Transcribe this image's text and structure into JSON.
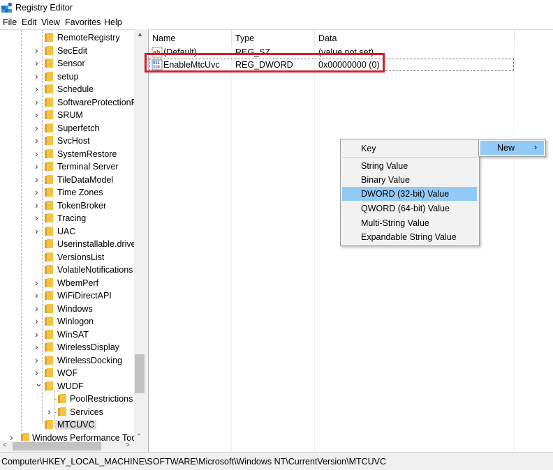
{
  "window": {
    "title": "Registry Editor"
  },
  "menu": [
    "File",
    "Edit",
    "View",
    "Favorites",
    "Help"
  ],
  "tree": [
    {
      "label": "RemoteRegistry",
      "chevron": ""
    },
    {
      "label": "SecEdit",
      "chevron": "›"
    },
    {
      "label": "Sensor",
      "chevron": "›"
    },
    {
      "label": "setup",
      "chevron": "›"
    },
    {
      "label": "Schedule",
      "chevron": "›"
    },
    {
      "label": "SoftwareProtectionPl",
      "chevron": "›"
    },
    {
      "label": "SRUM",
      "chevron": "›"
    },
    {
      "label": "Superfetch",
      "chevron": "›"
    },
    {
      "label": "SvcHost",
      "chevron": "›"
    },
    {
      "label": "SystemRestore",
      "chevron": "›"
    },
    {
      "label": "Terminal Server",
      "chevron": "›"
    },
    {
      "label": "TileDataModel",
      "chevron": "›"
    },
    {
      "label": "Time Zones",
      "chevron": "›"
    },
    {
      "label": "TokenBroker",
      "chevron": "›"
    },
    {
      "label": "Tracing",
      "chevron": "›"
    },
    {
      "label": "UAC",
      "chevron": "›"
    },
    {
      "label": "Userinstallable.driver",
      "chevron": ""
    },
    {
      "label": "VersionsList",
      "chevron": ""
    },
    {
      "label": "VolatileNotifications",
      "chevron": ""
    },
    {
      "label": "WbemPerf",
      "chevron": "›"
    },
    {
      "label": "WiFiDirectAPI",
      "chevron": "›"
    },
    {
      "label": "Windows",
      "chevron": "›"
    },
    {
      "label": "Winlogon",
      "chevron": "›"
    },
    {
      "label": "WinSAT",
      "chevron": "›"
    },
    {
      "label": "WirelessDisplay",
      "chevron": "›"
    },
    {
      "label": "WirelessDocking",
      "chevron": "›"
    },
    {
      "label": "WOF",
      "chevron": "›"
    },
    {
      "label": "WUDF",
      "chevron": "⌄"
    },
    {
      "label": "PoolRestrictions",
      "chevron": ""
    },
    {
      "label": "Services",
      "chevron": "›"
    },
    {
      "label": "MTCUVC",
      "chevron": ""
    },
    {
      "label": "Windows Performance Tool",
      "chevron": "›"
    }
  ],
  "columns": {
    "name": "Name",
    "type": "Type",
    "data": "Data"
  },
  "values": [
    {
      "name": "(Default)",
      "type": "REG_SZ",
      "data": "(value not set)",
      "icon_text": "ab"
    },
    {
      "name": "EnableMtcUvc",
      "type": "REG_DWORD",
      "data": "0x00000000 (0)",
      "icon_text": "011"
    }
  ],
  "context_menu": {
    "items": [
      "Key",
      "String Value",
      "Binary Value",
      "DWORD (32-bit) Value",
      "QWORD (64-bit) Value",
      "Multi-String Value",
      "Expandable String Value"
    ],
    "highlighted": "DWORD (32-bit) Value"
  },
  "submenu": {
    "label": "New",
    "arrow": "›"
  },
  "status": {
    "path": "Computer\\HKEY_LOCAL_MACHINE\\SOFTWARE\\Microsoft\\Windows NT\\CurrentVersion\\MTCUVC"
  },
  "colors": {
    "highlight": "#91c9f7",
    "annotation": "#d01f2e",
    "folder": "#f5c342"
  }
}
